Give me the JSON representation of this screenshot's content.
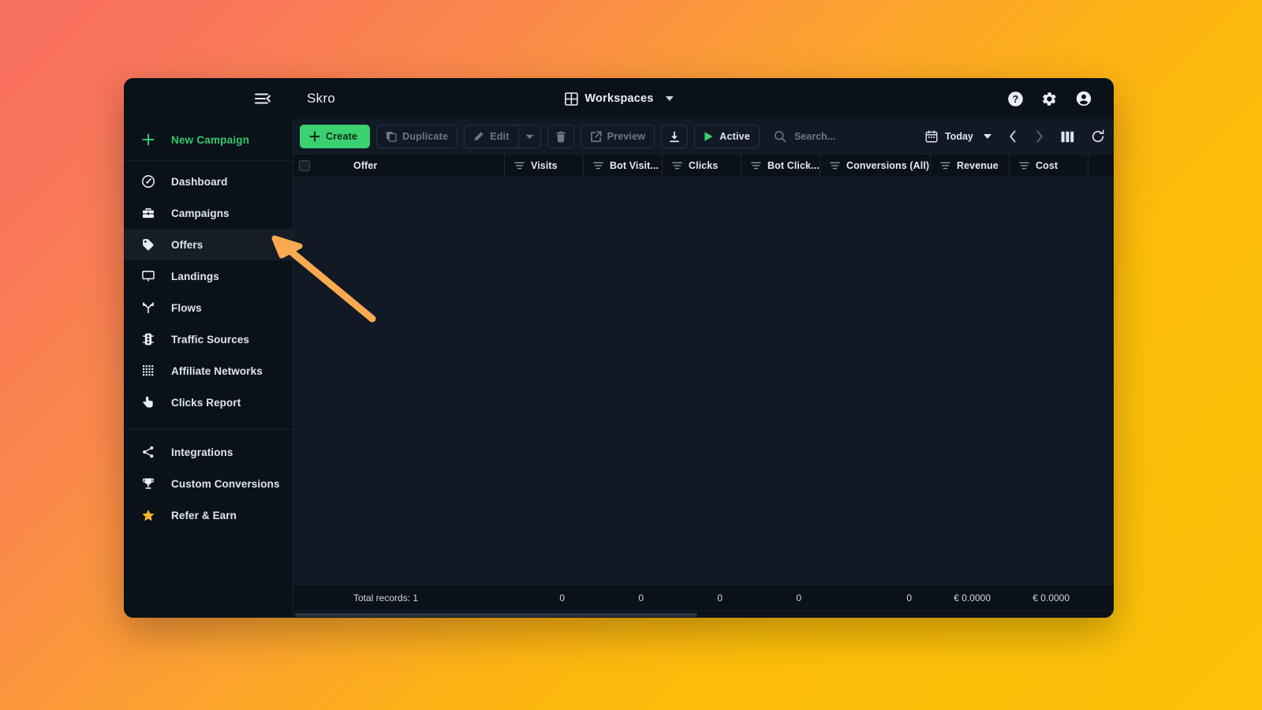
{
  "theme": {
    "bg_gradient_from": "#f8705f",
    "bg_gradient_to": "#fbc209",
    "window_bg": "#0d141c",
    "panel_bg": "#0b1119",
    "accent_green": "#3bd070",
    "annotation_color": "#f9a council"
  },
  "topbar": {
    "hamburger_icon": "menu-collapse-icon",
    "brand": "Skro",
    "workspaces_label": "Workspaces",
    "workspaces_icon": "grid-icon",
    "help_icon": "help-circle-icon",
    "settings_icon": "gear-icon",
    "account_icon": "account-circle-icon"
  },
  "sidebar": {
    "new_campaign": {
      "label": "New Campaign",
      "icon": "plus-icon"
    },
    "items": [
      {
        "label": "Dashboard",
        "icon": "gauge-icon",
        "active": false
      },
      {
        "label": "Campaigns",
        "icon": "briefcase-icon",
        "active": false
      },
      {
        "label": "Offers",
        "icon": "tag-icon",
        "active": true
      },
      {
        "label": "Landings",
        "icon": "monitor-icon",
        "active": false
      },
      {
        "label": "Flows",
        "icon": "branch-icon",
        "active": false
      },
      {
        "label": "Traffic Sources",
        "icon": "traffic-light-icon",
        "active": false
      },
      {
        "label": "Affiliate Networks",
        "icon": "grid-dots-icon",
        "active": false
      },
      {
        "label": "Clicks Report",
        "icon": "click-hand-icon",
        "active": false
      }
    ],
    "secondary_items": [
      {
        "label": "Integrations",
        "icon": "share-icon"
      },
      {
        "label": "Custom Conversions",
        "icon": "trophy-icon"
      },
      {
        "label": "Refer & Earn",
        "icon": "star-icon"
      }
    ]
  },
  "toolbar": {
    "create_label": "Create",
    "create_icon": "plus-icon",
    "duplicate_label": "Duplicate",
    "duplicate_icon": "copy-icon",
    "edit_label": "Edit",
    "edit_icon": "pencil-icon",
    "edit_caret_icon": "chevron-down-icon",
    "delete_icon": "trash-icon",
    "preview_label": "Preview",
    "preview_icon": "external-link-icon",
    "download_icon": "download-icon",
    "active_label": "Active",
    "active_icon": "play-icon",
    "search_icon": "search-icon",
    "search_value": "",
    "search_placeholder": "Search...",
    "date_label": "Today",
    "date_icon": "calendar-icon",
    "date_caret_icon": "chevron-down-icon",
    "prev_icon": "chevron-left-icon",
    "next_icon": "chevron-right-icon",
    "columns_icon": "columns-icon",
    "refresh_icon": "refresh-icon"
  },
  "table": {
    "select_all_checkbox": false,
    "columns": [
      {
        "label": "Offer",
        "filter": false,
        "type": "offer"
      },
      {
        "label": "Visits",
        "filter": true,
        "type": "num"
      },
      {
        "label": "Bot Visit...",
        "filter": true,
        "type": "num"
      },
      {
        "label": "Clicks",
        "filter": true,
        "type": "num"
      },
      {
        "label": "Bot Click...",
        "filter": true,
        "type": "num"
      },
      {
        "label": "Conversions (All)",
        "filter": true,
        "type": "wide"
      },
      {
        "label": "Revenue",
        "filter": true,
        "type": "num"
      },
      {
        "label": "Cost",
        "filter": true,
        "type": "num"
      }
    ],
    "rows": [],
    "footer": {
      "records_label": "Total records: 1",
      "values": [
        "0",
        "0",
        "0",
        "0",
        "0",
        "€ 0.0000",
        "€ 0.0000"
      ]
    }
  },
  "annotation": {
    "type": "arrow",
    "points_to": "sidebar-item-offers",
    "color": "#f9a94f"
  }
}
